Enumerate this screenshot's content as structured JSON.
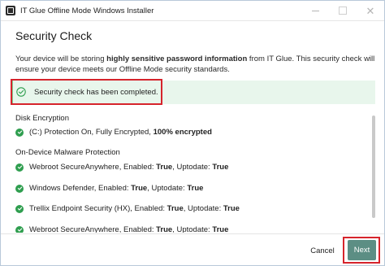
{
  "window": {
    "title": "IT Glue Offline Mode Windows Installer"
  },
  "page": {
    "heading": "Security Check",
    "description_parts": [
      "Your device will be storing ",
      "highly sensitive password information",
      " from IT Glue. This security check will ensure your device meets our Offline Mode security standards."
    ]
  },
  "status": {
    "message": "Security check has been completed.",
    "color": "#2f9e4f",
    "panel_color": "#e8f6ec"
  },
  "sections": [
    {
      "title": "Disk Encryption",
      "items": [
        {
          "text": "(C:) Protection On, Fully Encrypted, ",
          "bold": "100% encrypted"
        }
      ]
    },
    {
      "title": "On-Device Malware Protection",
      "items": [
        {
          "text": "Webroot SecureAnywhere, Enabled: ",
          "bold1": "True",
          "text2": ", Uptodate: ",
          "bold2": "True"
        },
        {
          "text": "Windows Defender, Enabled: ",
          "bold1": "True",
          "text2": ", Uptodate: ",
          "bold2": "True"
        },
        {
          "text": "Trellix Endpoint Security (HX), Enabled: ",
          "bold1": "True",
          "text2": ", Uptodate: ",
          "bold2": "True"
        },
        {
          "text": "Webroot SecureAnywhere, Enabled: ",
          "bold1": "True",
          "text2": ", Uptodate: ",
          "bold2": "True"
        }
      ]
    }
  ],
  "footer": {
    "cancel_label": "Cancel",
    "next_label": "Next",
    "next_color": "#5c8e84",
    "highlight_color": "#d6242c"
  }
}
